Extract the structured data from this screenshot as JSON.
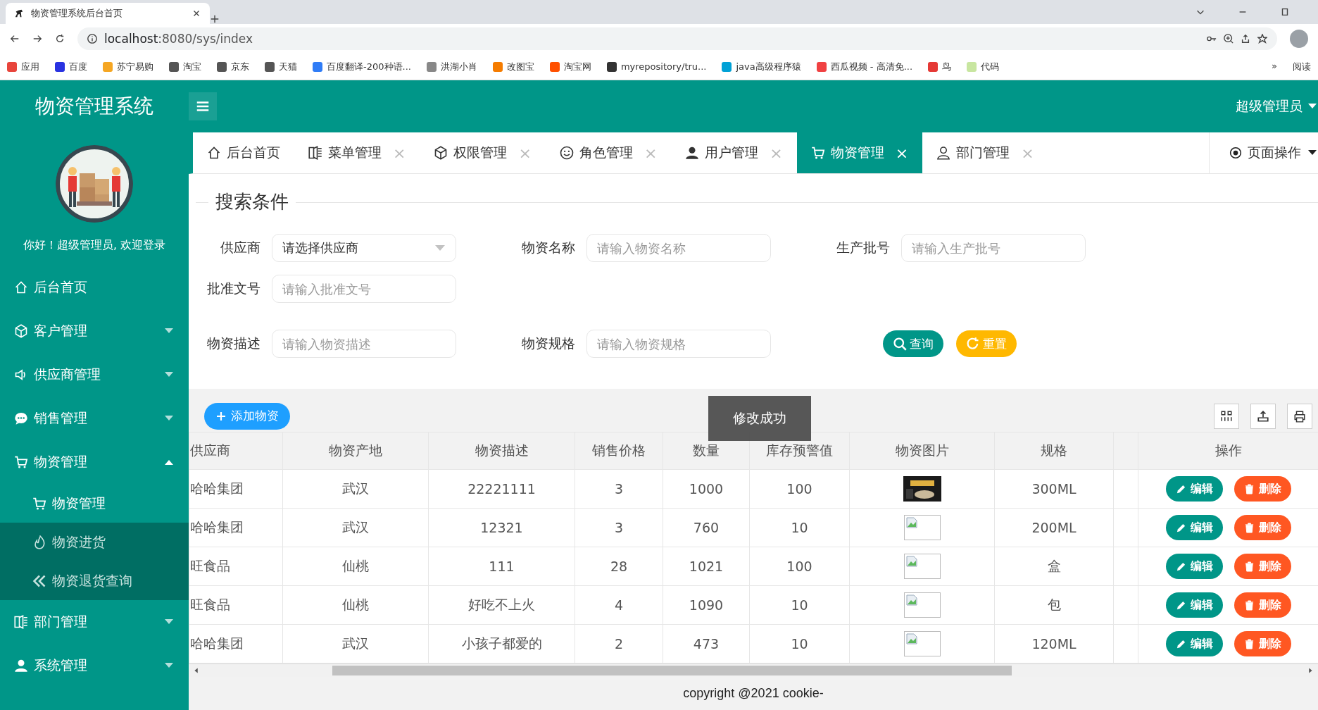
{
  "browser": {
    "tab_title": "物资管理系统后台首页",
    "address_host": "localhost",
    "address_path": ":8080/sys/index",
    "bookmarks": [
      "应用",
      "百度",
      "苏宁易购",
      "淘宝",
      "京东",
      "天猫",
      "百度翻译-200种语...",
      "洪湖小肖",
      "改图宝",
      "淘宝网",
      "myrepository/tru...",
      "java高级程序猿",
      "西瓜视频 - 高清免...",
      "鸟",
      "代码"
    ],
    "overflow": "»",
    "reading_list": "阅读"
  },
  "header": {
    "title": "物资管理系统",
    "user": "超级管理员"
  },
  "sidebar": {
    "greeting": "你好！超级管理员, 欢迎登录",
    "items": [
      {
        "label": "后台首页"
      },
      {
        "label": "客户管理",
        "expanded": false
      },
      {
        "label": "供应商管理",
        "expanded": false
      },
      {
        "label": "销售管理",
        "expanded": false
      },
      {
        "label": "物资管理",
        "expanded": true,
        "children": [
          {
            "label": "物资管理",
            "selected": true
          },
          {
            "label": "物资进货",
            "selected": false
          },
          {
            "label": "物资退货查询",
            "selected": false
          }
        ]
      },
      {
        "label": "部门管理",
        "expanded": false
      },
      {
        "label": "系统管理",
        "expanded": false
      }
    ]
  },
  "tabs": [
    {
      "label": "后台首页",
      "selected": false
    },
    {
      "label": "菜单管理",
      "close": "×",
      "selected": false
    },
    {
      "label": "权限管理",
      "close": "×",
      "selected": false
    },
    {
      "label": "角色管理",
      "close": "×",
      "selected": false
    },
    {
      "label": "用户管理",
      "close": "×",
      "selected": false
    },
    {
      "label": "物资管理",
      "close": "×",
      "selected": true
    },
    {
      "label": "部门管理",
      "close": "×",
      "selected": false
    }
  ],
  "page_ops": "页面操作",
  "search": {
    "legend": "搜索条件",
    "rows": [
      [
        {
          "label": "供应商",
          "placeholder": "请选择供应商",
          "kind": "select"
        },
        {
          "label": "物资名称",
          "placeholder": "请输入物资名称",
          "kind": "input"
        },
        {
          "label": "生产批号",
          "placeholder": "请输入生产批号",
          "kind": "input"
        }
      ],
      [
        {
          "label": "批准文号",
          "placeholder": "请输入批准文号",
          "kind": "input"
        }
      ],
      [
        {
          "label": "物资描述",
          "placeholder": "请输入物资描述",
          "kind": "input"
        },
        {
          "label": "物资规格",
          "placeholder": "请输入物资规格",
          "kind": "input"
        }
      ]
    ],
    "buttons": [
      {
        "label": "查询",
        "kind": "query"
      },
      {
        "label": "重置",
        "kind": "reset"
      }
    ]
  },
  "add_button": "添加物资",
  "toast": "修改成功",
  "table": {
    "columns": [
      "供应商",
      "物资产地",
      "物资描述",
      "销售价格",
      "数量",
      "库存预警值",
      "物资图片",
      "规格",
      "",
      "操作"
    ],
    "rows": [
      {
        "cells": [
          "哈哈集团",
          "武汉",
          "22221111",
          "3",
          "1000",
          "100",
          "300ML"
        ],
        "edit": "编辑",
        "delete": "删除"
      },
      {
        "cells": [
          "哈哈集团",
          "武汉",
          "12321",
          "3",
          "760",
          "10",
          "200ML"
        ],
        "image": {
          "kind": "broken"
        },
        "edit": "编辑",
        "delete": "删除"
      },
      {
        "cells": [
          "旺食品",
          "仙桃",
          "111",
          "28",
          "1021",
          "100",
          "盒"
        ],
        "image": {
          "kind": "broken"
        },
        "edit": "编辑",
        "delete": "删除"
      },
      {
        "cells": [
          "旺食品",
          "仙桃",
          "好吃不上火",
          "4",
          "1090",
          "10",
          "包"
        ],
        "image": {
          "kind": "broken"
        },
        "edit": "编辑",
        "delete": "删除"
      },
      {
        "cells": [
          "哈哈集团",
          "武汉",
          "小孩子都爱的",
          "2",
          "473",
          "10",
          "120ML"
        ],
        "image": {
          "kind": "broken"
        },
        "edit": "编辑",
        "delete": "删除"
      }
    ]
  },
  "footer": "copyright @2021 cookie-"
}
